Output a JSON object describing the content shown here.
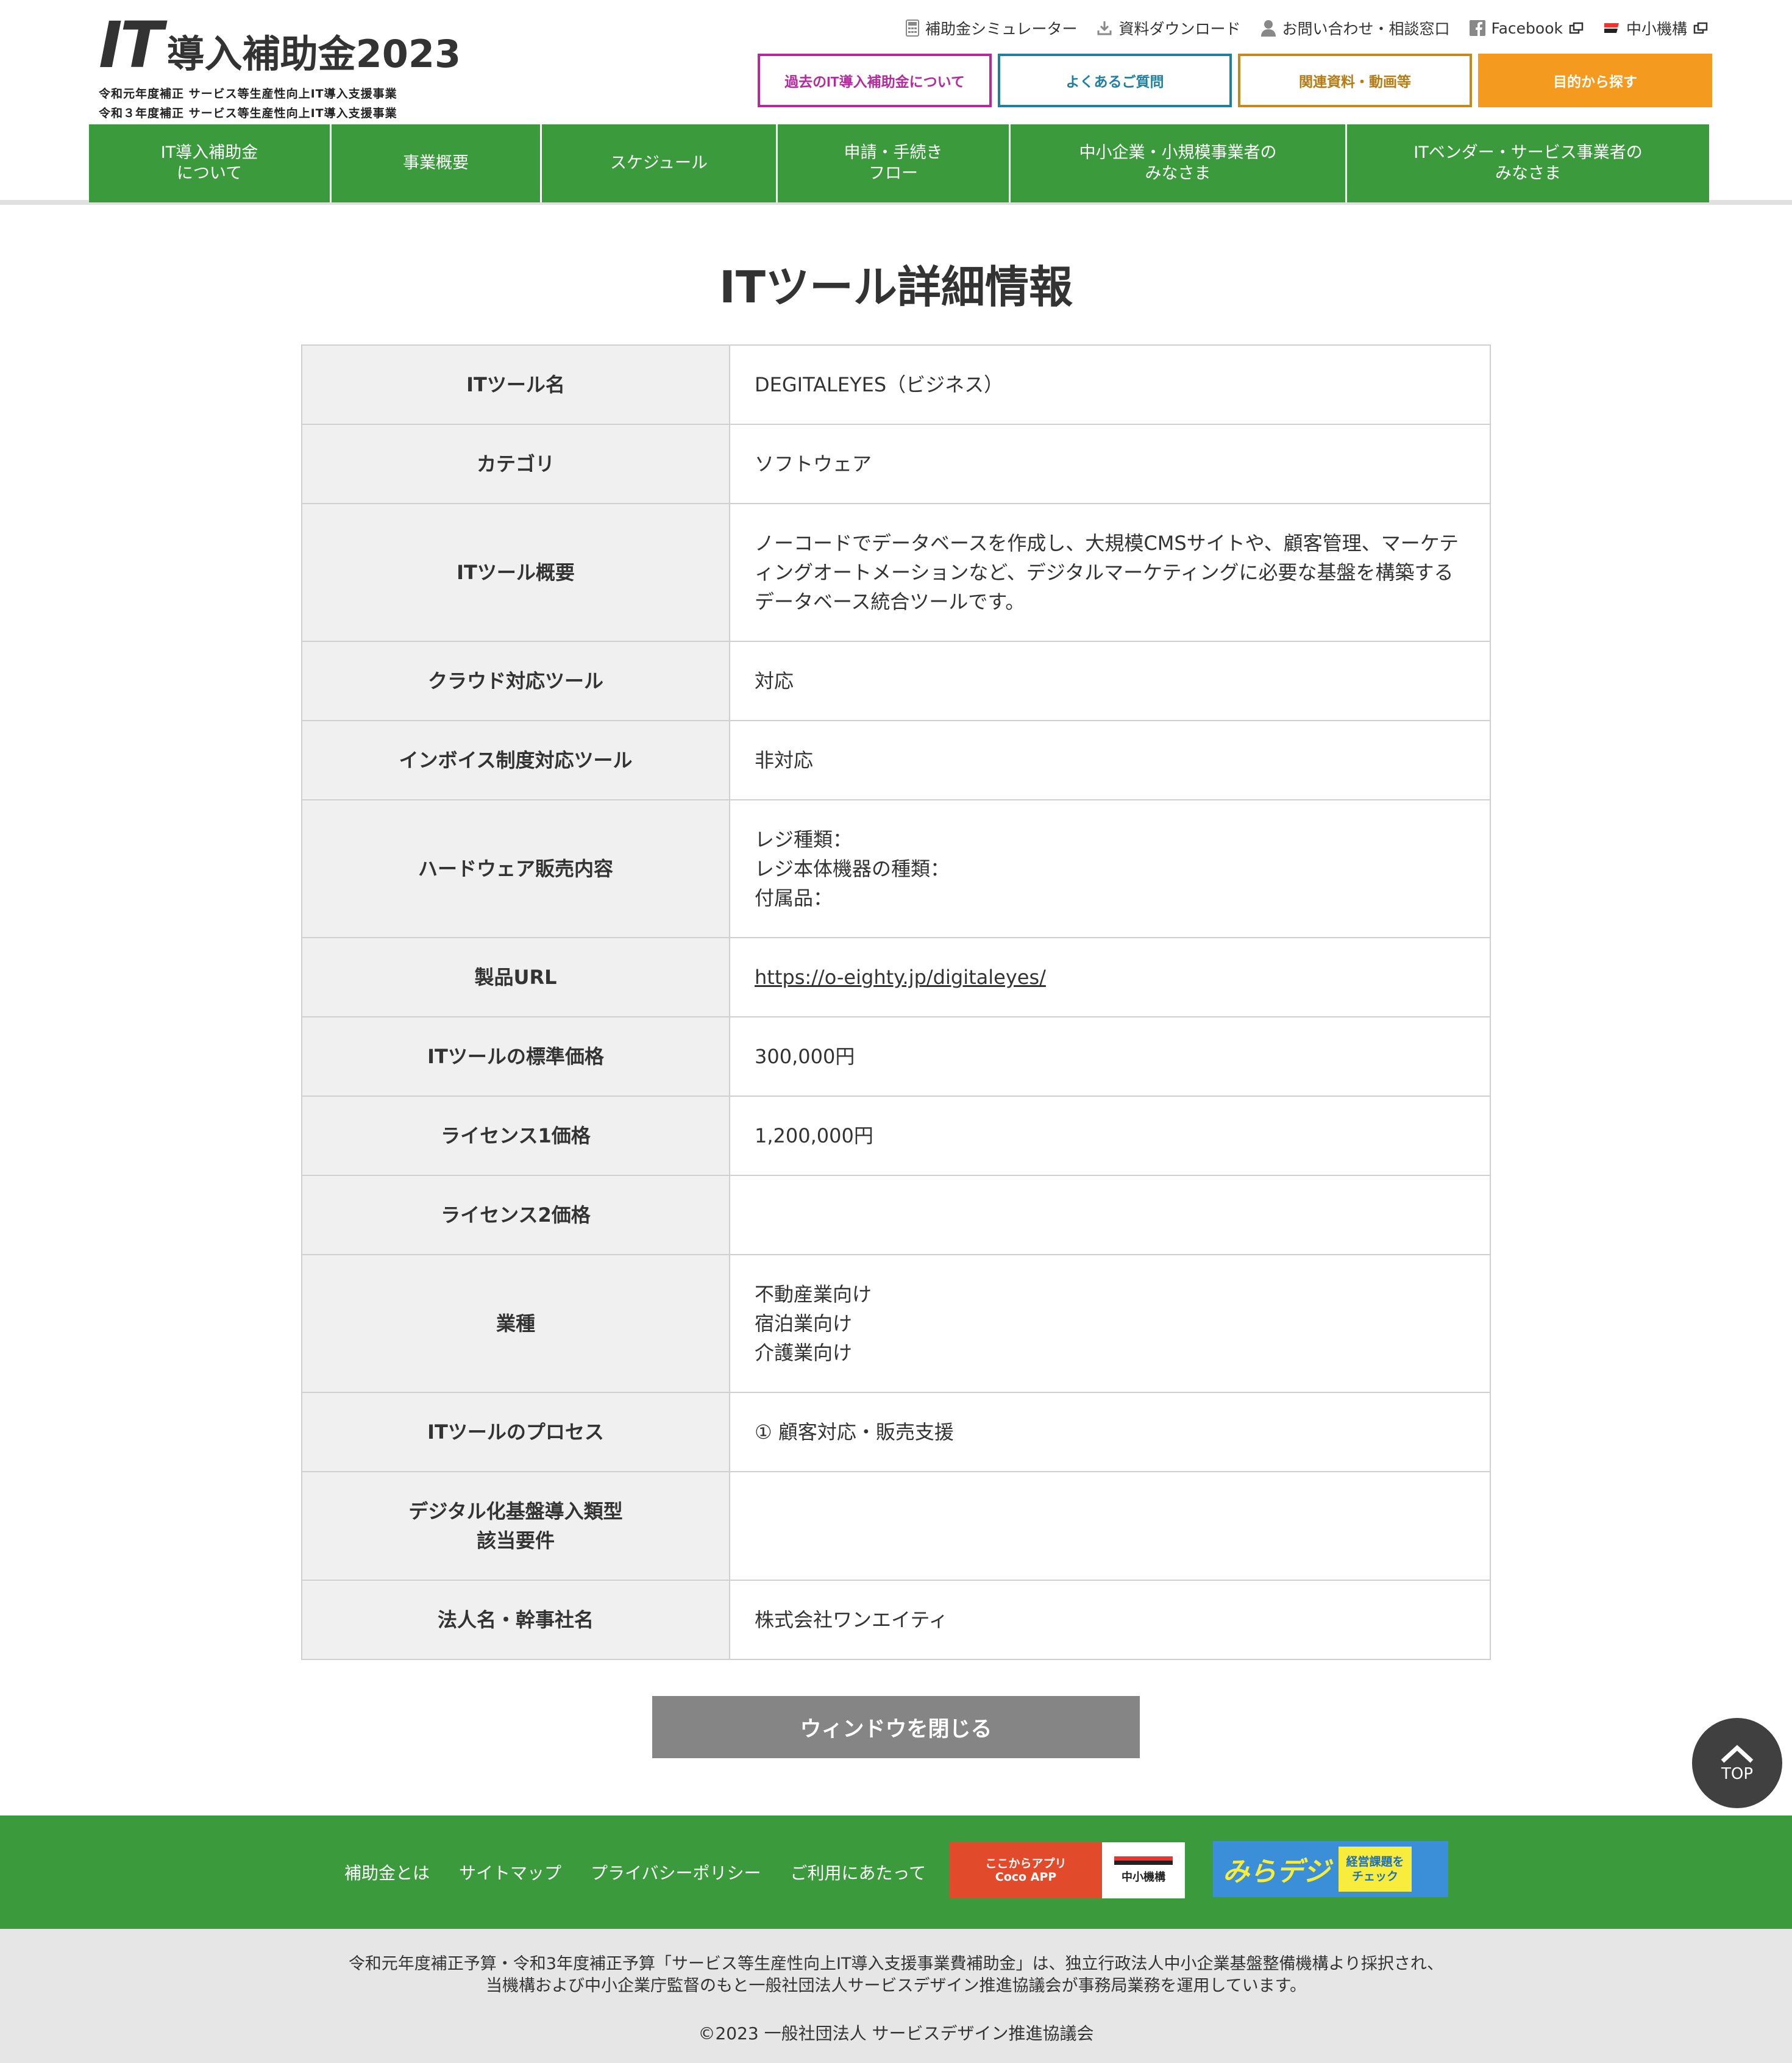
{
  "header": {
    "logo_it": "IT",
    "logo_rest": "導入補助金2023",
    "logo_sub1": "令和元年度補正 サービス等生産性向上IT導入支援事業",
    "logo_sub2": "令和３年度補正 サービス等生産性向上IT導入支援事業",
    "util_nav": {
      "simulator": "補助金シミュレーター",
      "download": "資料ダウンロード",
      "contact": "お問い合わせ・相談窓口",
      "facebook": "Facebook",
      "smrj": "中小機構"
    },
    "quick_buttons": {
      "past": "過去のIT導入補助金について",
      "faq": "よくあるご質問",
      "docs": "関連資料・動画等",
      "purpose": "目的から探す"
    },
    "gnav": [
      "IT導入補助金\nについて",
      "事業概要",
      "スケジュール",
      "申請・手続き\nフロー",
      "中小企業・小規模事業者の\nみなさま",
      "ITベンダー・サービス事業者の\nみなさま"
    ]
  },
  "main": {
    "title": "ITツール詳細情報",
    "rows": [
      {
        "label": "ITツール名",
        "value": "DEGITALEYES（ビジネス）"
      },
      {
        "label": "カテゴリ",
        "value": "ソフトウェア"
      },
      {
        "label": "ITツール概要",
        "value": "ノーコードでデータベースを作成し、大規模CMSサイトや、顧客管理、マーケテ\nィングオートメーションなど、デジタルマーケティングに必要な基盤を構築する\nデータベース統合ツールです。"
      },
      {
        "label": "クラウド対応ツール",
        "value": "対応"
      },
      {
        "label": "インボイス制度対応ツール",
        "value": "非対応"
      },
      {
        "label": "ハードウェア販売内容",
        "value": "レジ種類：\nレジ本体機器の種類：\n付属品："
      },
      {
        "label": "製品URL",
        "value": "https://o-eighty.jp/digitaleyes/"
      },
      {
        "label": "ITツールの標準価格",
        "value": "300,000円"
      },
      {
        "label": "ライセンス1価格",
        "value": "1,200,000円"
      },
      {
        "label": "ライセンス2価格",
        "value": ""
      },
      {
        "label": "業種",
        "value": "不動産業向け\n宿泊業向け\n介護業向け"
      },
      {
        "label": "ITツールのプロセス",
        "value": "① 顧客対応・販売支援"
      },
      {
        "label": "デジタル化基盤導入類型\n該当要件",
        "value": ""
      },
      {
        "label": "法人名・幹事社名",
        "value": "株式会社ワンエイティ"
      }
    ],
    "close_button": "ウィンドウを閉じる",
    "to_top": "TOP"
  },
  "footer": {
    "links": [
      "補助金とは",
      "サイトマップ",
      "プライバシーポリシー",
      "ご利用にあたって"
    ],
    "banner1_line1": "ここからアプリ",
    "banner1_line2": "Coco APP",
    "banner1_org": "中小機構",
    "banner2_main": "みらデジ",
    "banner2_tag": "経営課題を\nチェック",
    "note": "令和元年度補正予算・令和3年度補正予算「サービス等生産性向上IT導入支援事業費補助金」は、独立行政法人中小企業基盤整備機構より採択され、\n当機構および中小企業庁監督のもと一般社団法人サービスデザイン推進協議会が事務局業務を運用しています。",
    "copyright": "©2023 一般社団法人 サービスデザイン推進協議会"
  }
}
